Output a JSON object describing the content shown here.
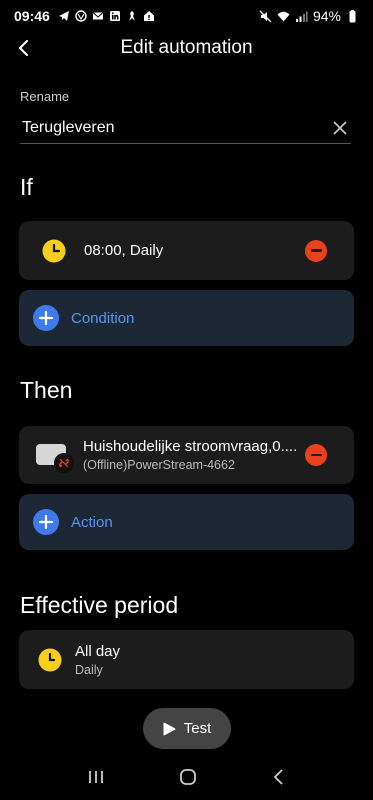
{
  "status": {
    "time": "09:46",
    "battery": "94%"
  },
  "header": {
    "title": "Edit automation"
  },
  "rename": {
    "label": "Rename",
    "value": "Terugleveren"
  },
  "if_section": {
    "title": "If",
    "trigger": {
      "text": "08:00, Daily"
    },
    "add_condition_label": "Condition"
  },
  "then_section": {
    "title": "Then",
    "action": {
      "title": "Huishoudelijke stroomvraag,0....",
      "subtitle": "(Offline)PowerStream-4662"
    },
    "add_action_label": "Action"
  },
  "effective_period": {
    "title": "Effective period",
    "value": "All day",
    "sub": "Daily"
  },
  "test_button": {
    "label": "Test"
  },
  "colors": {
    "accent": "#3f7be8",
    "remove": "#e8411b",
    "clock": "#f7cf1b"
  }
}
